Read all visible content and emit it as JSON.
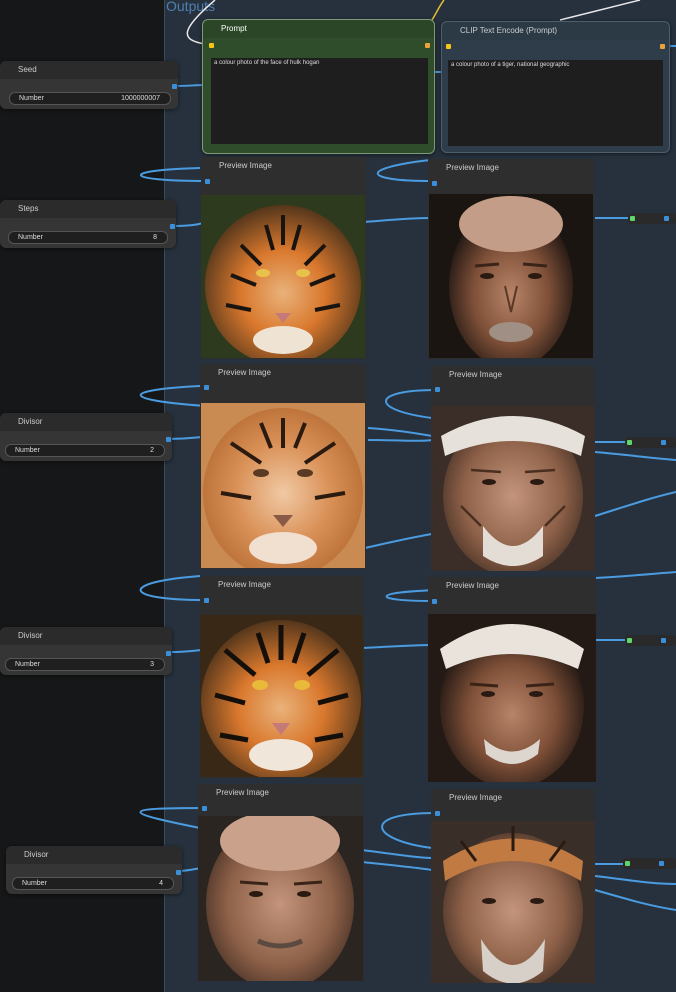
{
  "group": {
    "title": "Outputs"
  },
  "seed_node": {
    "title": "Seed",
    "widget_label": "Number",
    "widget_value": "1000000007"
  },
  "steps_node": {
    "title": "Steps",
    "widget_label": "Number",
    "widget_value": "8"
  },
  "divisor_nodes": [
    {
      "title": "Divisor",
      "widget_label": "Number",
      "widget_value": "2"
    },
    {
      "title": "Divisor",
      "widget_label": "Number",
      "widget_value": "3"
    },
    {
      "title": "Divisor",
      "widget_label": "Number",
      "widget_value": "4"
    }
  ],
  "prompt_node": {
    "title": "Prompt",
    "text": "a colour photo of the face of hulk hogan"
  },
  "clip_node": {
    "title": "CLIP Text Encode (Prompt)",
    "text": "a colour photo of a tiger, national geographic"
  },
  "preview_nodes": [
    {
      "title": "Preview Image",
      "subject": "tiger"
    },
    {
      "title": "Preview Image",
      "subject": "man"
    },
    {
      "title": "Preview Image",
      "subject": "tiger"
    },
    {
      "title": "Preview Image",
      "subject": "man"
    },
    {
      "title": "Preview Image",
      "subject": "tiger"
    },
    {
      "title": "Preview Image",
      "subject": "man"
    },
    {
      "title": "Preview Image",
      "subject": "man"
    },
    {
      "title": "Preview Image",
      "subject": "hybrid"
    }
  ],
  "colors": {
    "wire": "#4a9be0",
    "prompt_bg": "#2f4d2a",
    "clip_bg": "#2f3d4a",
    "group_bg": "#26313d",
    "slot_yellow": "#f5c518",
    "slot_orange": "#e8a33b",
    "slot_green": "#5fd66a",
    "slot_blue": "#3a8fd8"
  }
}
